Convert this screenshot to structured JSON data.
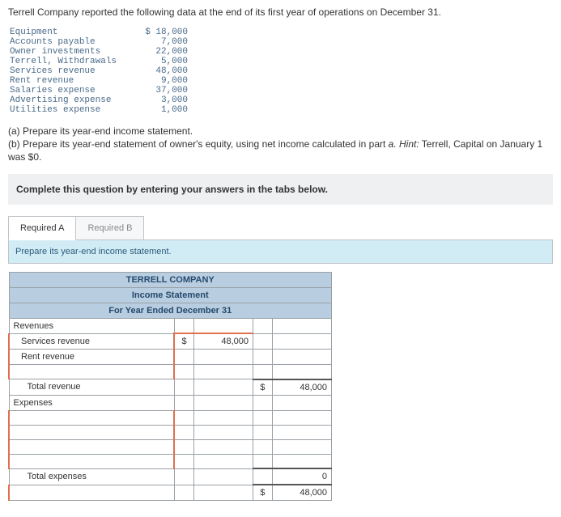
{
  "intro": "Terrell Company reported the following data at the end of its first year of operations on December 31.",
  "given": [
    {
      "label": "Equipment",
      "val": "$ 18,000"
    },
    {
      "label": "Accounts payable",
      "val": "7,000"
    },
    {
      "label": "Owner investments",
      "val": "22,000"
    },
    {
      "label": "Terrell, Withdrawals",
      "val": "5,000"
    },
    {
      "label": "Services revenue",
      "val": "48,000"
    },
    {
      "label": "Rent revenue",
      "val": "9,000"
    },
    {
      "label": "Salaries expense",
      "val": "37,000"
    },
    {
      "label": "Advertising expense",
      "val": "3,000"
    },
    {
      "label": "Utilities expense",
      "val": "1,000"
    }
  ],
  "q": {
    "a_label": "(a)",
    "a": "Prepare its year-end income statement.",
    "b_label": "(b)",
    "b_pre": "Prepare its year-end statement of owner's equity, using net income calculated in part ",
    "b_part": "a. ",
    "b_hint_label": "Hint:",
    "b_hint": " Terrell, Capital on January 1 was $0."
  },
  "complete": "Complete this question by entering your answers in the tabs below.",
  "tabs": {
    "a": "Required A",
    "b": "Required B"
  },
  "prompt": "Prepare its year-end income statement.",
  "stmt": {
    "company": "TERRELL COMPANY",
    "title": "Income Statement",
    "period": "For Year Ended December 31",
    "revenues_h": "Revenues",
    "serv_rev": "Services revenue",
    "serv_rev_c": "$",
    "serv_rev_v": "48,000",
    "rent_rev": "Rent revenue",
    "total_rev": "Total revenue",
    "total_rev_c": "$",
    "total_rev_v": "48,000",
    "expenses_h": "Expenses",
    "total_exp": "Total expenses",
    "total_exp_v": "0",
    "net_c": "$",
    "net_v": "48,000"
  },
  "chart_data": {
    "type": "table",
    "title": "TERRELL COMPANY Income Statement For Year Ended December 31",
    "rows": [
      {
        "section": "Revenues",
        "item": "Services revenue",
        "col1": 48000,
        "col2": null
      },
      {
        "section": "Revenues",
        "item": "Rent revenue",
        "col1": null,
        "col2": null
      },
      {
        "section": "Revenues",
        "item": "Total revenue",
        "col1": null,
        "col2": 48000
      },
      {
        "section": "Expenses",
        "item": "Total expenses",
        "col1": null,
        "col2": 0
      },
      {
        "section": "",
        "item": "",
        "col1": null,
        "col2": 48000
      }
    ]
  }
}
